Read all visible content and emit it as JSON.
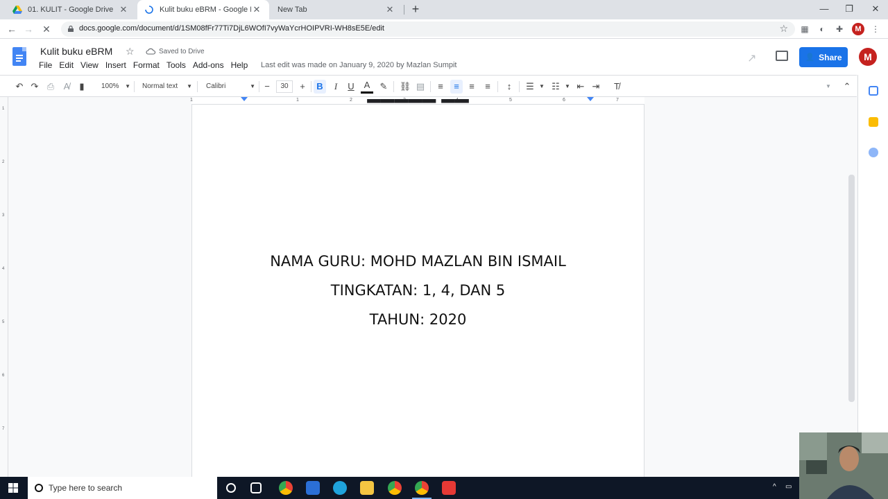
{
  "browser": {
    "tabs": [
      {
        "title": "01. KULIT - Google Drive"
      },
      {
        "title": "Kulit buku eBRM - Google Docs"
      },
      {
        "title": "New Tab"
      }
    ],
    "url": "docs.google.com/document/d/1SM08fFr77Ti7DjL6WOfI7vyWaYcrHOIPVRI-WH8sE5E/edit",
    "profile_initial": "M"
  },
  "doc": {
    "title": "Kulit buku eBRM",
    "save_status": "Saved to Drive",
    "menu": [
      "File",
      "Edit",
      "View",
      "Insert",
      "Format",
      "Tools",
      "Add-ons",
      "Help"
    ],
    "last_edit": "Last edit was made on January 9, 2020 by Mazlan Sumpit",
    "share_label": "Share",
    "avatar_initial": "M"
  },
  "toolbar": {
    "zoom": "100%",
    "style": "Normal text",
    "font": "Calibri",
    "font_size": "30"
  },
  "ruler": {
    "h_numbers": [
      "1",
      "1",
      "2",
      "3",
      "4",
      "5",
      "6",
      "7"
    ],
    "v_numbers": [
      "1",
      "2",
      "3",
      "4",
      "5",
      "6",
      "7"
    ]
  },
  "page": {
    "lines": [
      "NAMA GURU: MOHD MAZLAN BIN ISMAIL",
      "TINGKATAN: 1, 4, DAN 5",
      "TAHUN: 2020"
    ]
  },
  "taskbar": {
    "search_placeholder": "Type here to search"
  },
  "colors": {
    "accent": "#1a73e8",
    "avatar": "#c5221f",
    "docs_blue": "#4285f4"
  }
}
